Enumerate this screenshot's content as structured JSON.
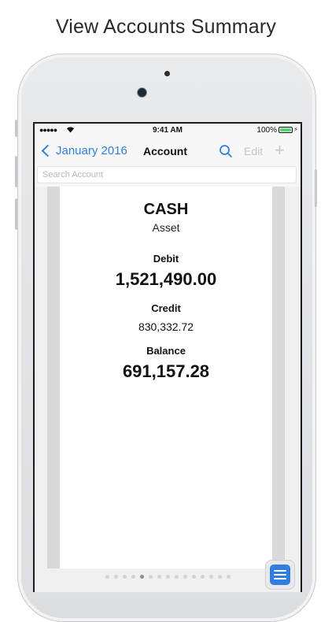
{
  "headline": "View Accounts Summary",
  "status_bar": {
    "signal": "●●●●●",
    "time": "9:41 AM",
    "battery_percent": "100%",
    "battery_level": 1.0
  },
  "nav": {
    "back_label": "January 2016",
    "title": "Account",
    "edit_label": "Edit",
    "add_label": "+"
  },
  "search": {
    "placeholder": "Search Account",
    "value": ""
  },
  "account": {
    "name": "CASH",
    "type": "Asset",
    "debit_label": "Debit",
    "debit_value": "1,521,490.00",
    "credit_label": "Credit",
    "credit_value": "830,332.72",
    "balance_label": "Balance",
    "balance_value": "691,157.28"
  },
  "pager": {
    "pages": 15,
    "active_index": 4
  },
  "colors": {
    "accent": "#2f7fe0",
    "disabled": "#c6c6ca",
    "battery": "#4cd964"
  },
  "icons": {
    "back": "chevron-left-icon",
    "search": "search-icon",
    "menu": "menu-icon",
    "wifi": "wifi-icon",
    "battery": "battery-icon",
    "charging": "bolt-icon"
  }
}
